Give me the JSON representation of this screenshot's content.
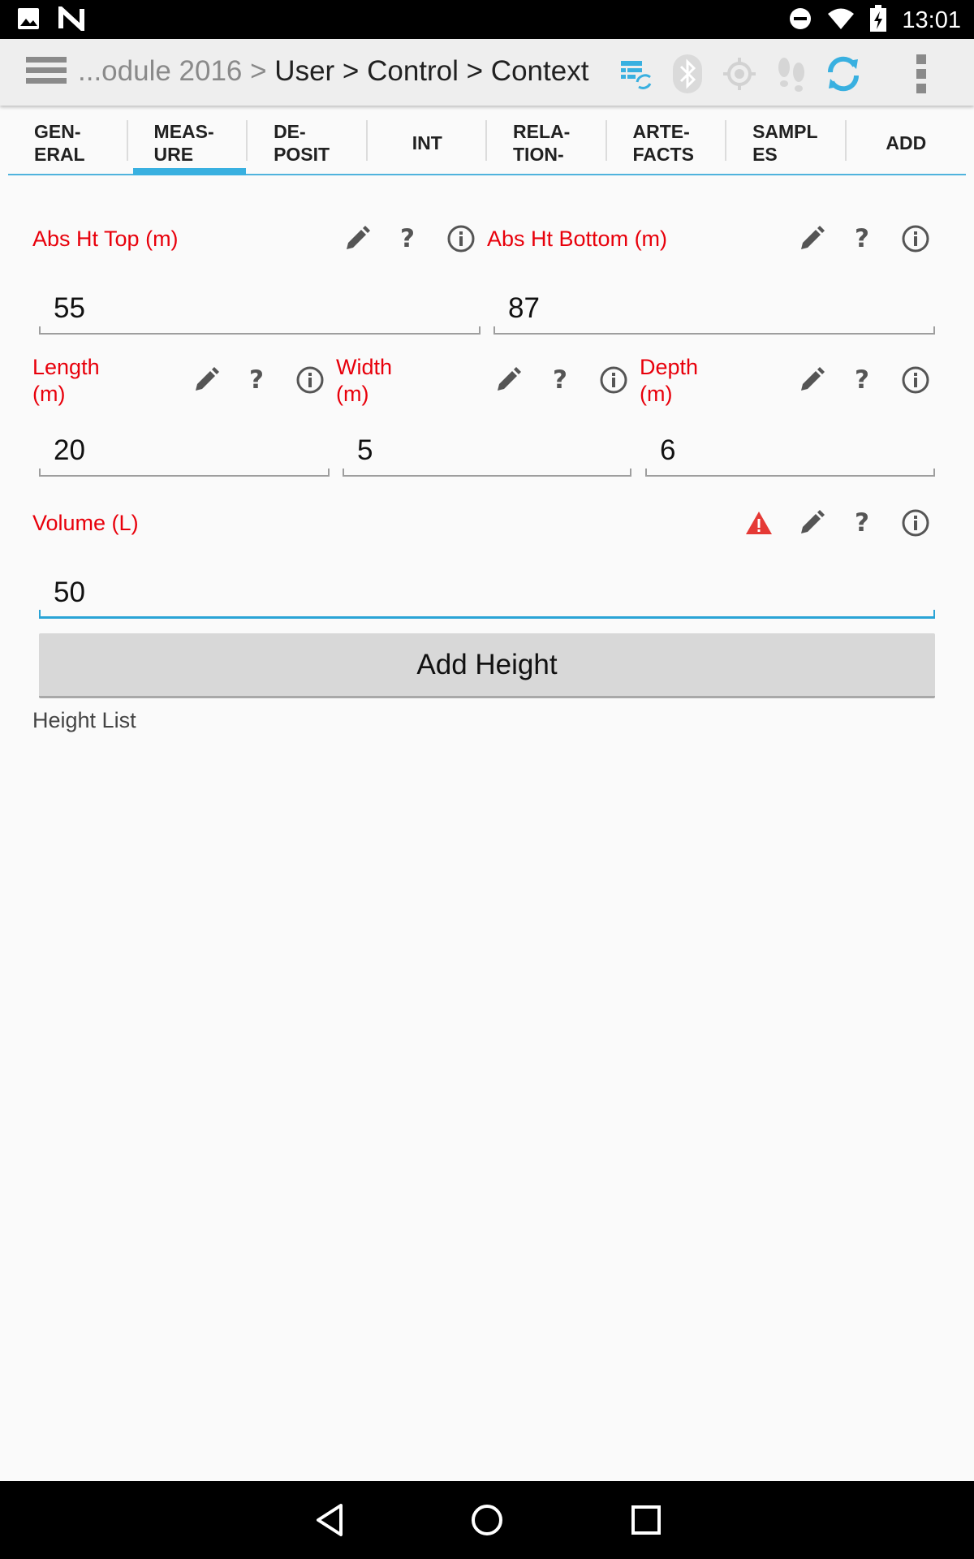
{
  "status_bar": {
    "time": "13:01",
    "icons": [
      "image-icon",
      "n-logo-icon",
      "do-not-disturb-icon",
      "wifi-icon",
      "battery-charging-icon"
    ]
  },
  "action_bar": {
    "breadcrumb_prefix": "...odule 2016 >",
    "breadcrumb_path": "User > Control > Context",
    "icons": [
      "menu-icon",
      "sync-tables-icon",
      "bluetooth-icon",
      "gps-target-icon",
      "footsteps-icon",
      "refresh-icon",
      "overflow-menu-icon"
    ],
    "accent_color": "#39b0e0"
  },
  "tabs": [
    {
      "label": "GEN-\nERAL",
      "active": false
    },
    {
      "label": "MEAS-\nURE",
      "active": true
    },
    {
      "label": "DE-\nPOSIT",
      "active": false
    },
    {
      "label": "INT",
      "active": false
    },
    {
      "label": "RELA-\nTION-",
      "active": false
    },
    {
      "label": "ARTE-\nFACTS",
      "active": false
    },
    {
      "label": "SAMPL\nES",
      "active": false
    },
    {
      "label": "ADD",
      "active": false
    }
  ],
  "form": {
    "label_color": "#e8000b",
    "abs_ht_top": {
      "label": "Abs Ht Top (m)",
      "value": "55"
    },
    "abs_ht_bottom": {
      "label": "Abs Ht Bottom (m)",
      "value": "87"
    },
    "length": {
      "label": "Length\n(m)",
      "value": "20"
    },
    "width": {
      "label": "Width\n(m)",
      "value": "5"
    },
    "depth": {
      "label": "Depth\n(m)",
      "value": "6"
    },
    "volume": {
      "label": "Volume (L)",
      "value": "50"
    },
    "help_glyph": "?",
    "add_height_button": "Add Height",
    "height_list_label": "Height List"
  },
  "nav_bar": {
    "icons": [
      "back-icon",
      "home-icon",
      "recents-icon"
    ]
  }
}
